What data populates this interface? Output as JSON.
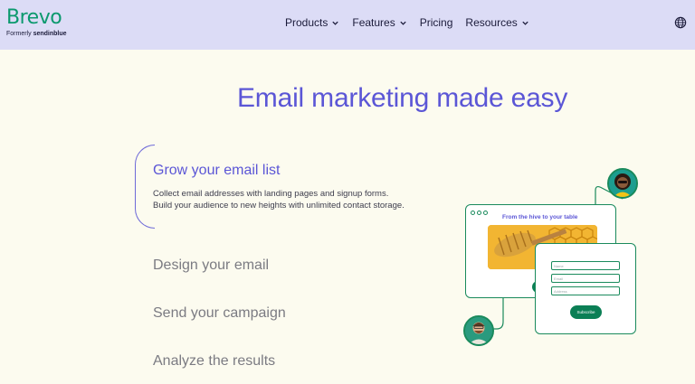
{
  "brand": {
    "name": "Brevo",
    "formerly_label": "Formerly",
    "formerly_name": "sendinblue",
    "color": "#0b996e"
  },
  "nav": {
    "items": [
      {
        "label": "Products",
        "has_dropdown": true
      },
      {
        "label": "Features",
        "has_dropdown": true
      },
      {
        "label": "Pricing",
        "has_dropdown": false
      },
      {
        "label": "Resources",
        "has_dropdown": true
      }
    ],
    "language_icon": "globe-icon"
  },
  "main": {
    "title": "Email marketing made easy",
    "features": {
      "active": {
        "title": "Grow your email list",
        "description_line1": "Collect email addresses with landing pages and signup forms.",
        "description_line2": "Build your audience to new heights with unlimited contact storage."
      },
      "others": [
        "Design your email",
        "Send your campaign",
        "Analyze the results"
      ]
    }
  },
  "illustration": {
    "card_title": "From the hive to your table",
    "form_fields": [
      "Name",
      "Email",
      "Address"
    ],
    "subscribe_label": "Subscribe"
  },
  "colors": {
    "accent": "#5b56d6",
    "header_bg": "#dcdcf6",
    "page_bg": "#fcfbef",
    "green": "#0b7f55"
  }
}
